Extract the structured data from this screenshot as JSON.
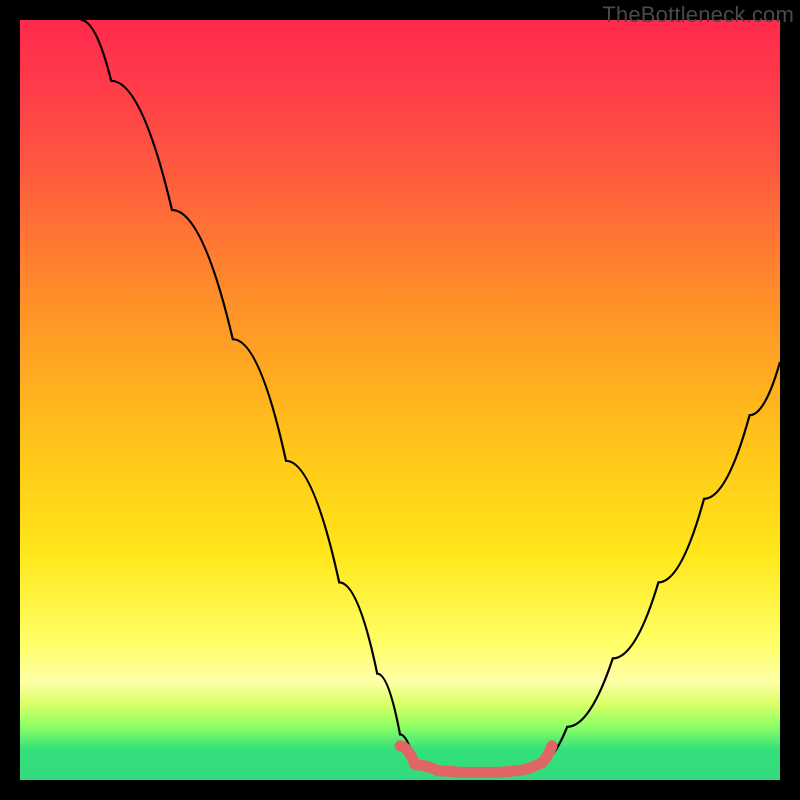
{
  "watermark": "TheBottleneck.com",
  "chart_data": {
    "type": "line",
    "title": "",
    "xlabel": "",
    "ylabel": "",
    "xlim": [
      0,
      100
    ],
    "ylim": [
      0,
      100
    ],
    "gradient_stops": [
      {
        "pct": 0,
        "color": "#ff2a4d"
      },
      {
        "pct": 8,
        "color": "#ff3a4a"
      },
      {
        "pct": 20,
        "color": "#ff5a3f"
      },
      {
        "pct": 35,
        "color": "#ff8a2a"
      },
      {
        "pct": 55,
        "color": "#ffc21a"
      },
      {
        "pct": 70,
        "color": "#ffe619"
      },
      {
        "pct": 82,
        "color": "#ffff66"
      },
      {
        "pct": 87,
        "color": "#ffffa8"
      },
      {
        "pct": 90,
        "color": "#d9ff66"
      },
      {
        "pct": 93,
        "color": "#8cff66"
      },
      {
        "pct": 96,
        "color": "#33e07a"
      },
      {
        "pct": 100,
        "color": "#33d97f"
      }
    ],
    "series": [
      {
        "name": "left-curve",
        "color": "#000000",
        "stroke_width": 2.2,
        "points": [
          {
            "x": 8,
            "y": 100
          },
          {
            "x": 12,
            "y": 92
          },
          {
            "x": 20,
            "y": 75
          },
          {
            "x": 28,
            "y": 58
          },
          {
            "x": 35,
            "y": 42
          },
          {
            "x": 42,
            "y": 26
          },
          {
            "x": 47,
            "y": 14
          },
          {
            "x": 50,
            "y": 6
          },
          {
            "x": 52,
            "y": 2
          }
        ]
      },
      {
        "name": "right-curve",
        "color": "#000000",
        "stroke_width": 2.2,
        "points": [
          {
            "x": 68,
            "y": 2
          },
          {
            "x": 72,
            "y": 7
          },
          {
            "x": 78,
            "y": 16
          },
          {
            "x": 84,
            "y": 26
          },
          {
            "x": 90,
            "y": 37
          },
          {
            "x": 96,
            "y": 48
          },
          {
            "x": 100,
            "y": 55
          }
        ]
      },
      {
        "name": "optimal-band",
        "color": "#e06666",
        "stroke_width": 11,
        "linecap": "round",
        "points": [
          {
            "x": 50,
            "y": 4.5
          },
          {
            "x": 52,
            "y": 2.0
          },
          {
            "x": 55,
            "y": 1.2
          },
          {
            "x": 58,
            "y": 1.0
          },
          {
            "x": 62,
            "y": 1.0
          },
          {
            "x": 65,
            "y": 1.2
          },
          {
            "x": 68,
            "y": 2.0
          },
          {
            "x": 70,
            "y": 4.5
          }
        ]
      }
    ]
  }
}
